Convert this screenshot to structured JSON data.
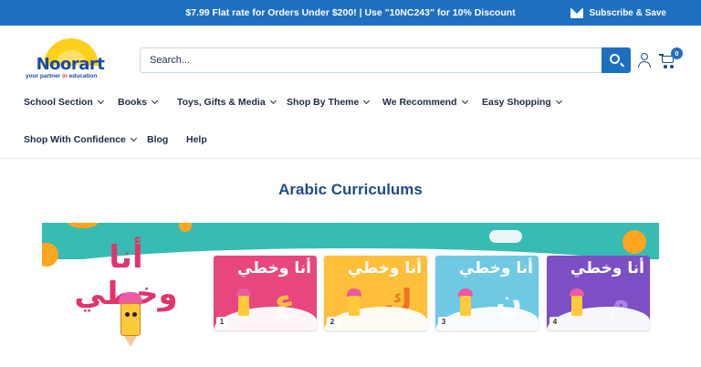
{
  "topbar": {
    "promo": "$7.99 Flat rate for Orders Under $200! | Use \"10NC243\" for 10% Discount",
    "subscribe_label": "Subscribe & Save"
  },
  "logo": {
    "brand": "Noorart",
    "tagline_pre": "your partner ",
    "tagline_in": "in",
    "tagline_post": " education"
  },
  "search": {
    "placeholder": "Search..."
  },
  "cart": {
    "count": "0"
  },
  "nav": {
    "items": [
      {
        "label": "School Section",
        "has_dropdown": true
      },
      {
        "label": "Books",
        "has_dropdown": true
      },
      {
        "label": "Toys, Gifts & Media",
        "has_dropdown": true
      },
      {
        "label": "Shop By Theme",
        "has_dropdown": true
      },
      {
        "label": "We Recommend",
        "has_dropdown": true
      },
      {
        "label": "Easy Shopping",
        "has_dropdown": true
      },
      {
        "label": "Shop With Confidence",
        "has_dropdown": true
      },
      {
        "label": "Blog",
        "has_dropdown": false
      },
      {
        "label": "Help",
        "has_dropdown": false
      }
    ]
  },
  "main": {
    "section_title": "Arabic Curriculums"
  },
  "banner": {
    "series_title": "أنا وخطي",
    "books": [
      {
        "title": "أنا وخطي",
        "number": "1",
        "letter": "ع",
        "color": "#e8467f",
        "letter_color": "#ffc93c"
      },
      {
        "title": "أنا وخطي",
        "number": "2",
        "letter": "ك",
        "color": "#ffbf3a",
        "letter_color": "#f06a1f"
      },
      {
        "title": "أنا وخطي",
        "number": "3",
        "letter": "ن",
        "color": "#6fc9e3",
        "letter_color": "#ffffff"
      },
      {
        "title": "أنا وخطي",
        "number": "4",
        "letter": "م",
        "color": "#7c4fc4",
        "letter_color": "#b08ae8"
      }
    ]
  },
  "colors": {
    "topbar": "#1f6fc0",
    "title": "#1f4c87",
    "banner_teal": "#36bcb2"
  }
}
